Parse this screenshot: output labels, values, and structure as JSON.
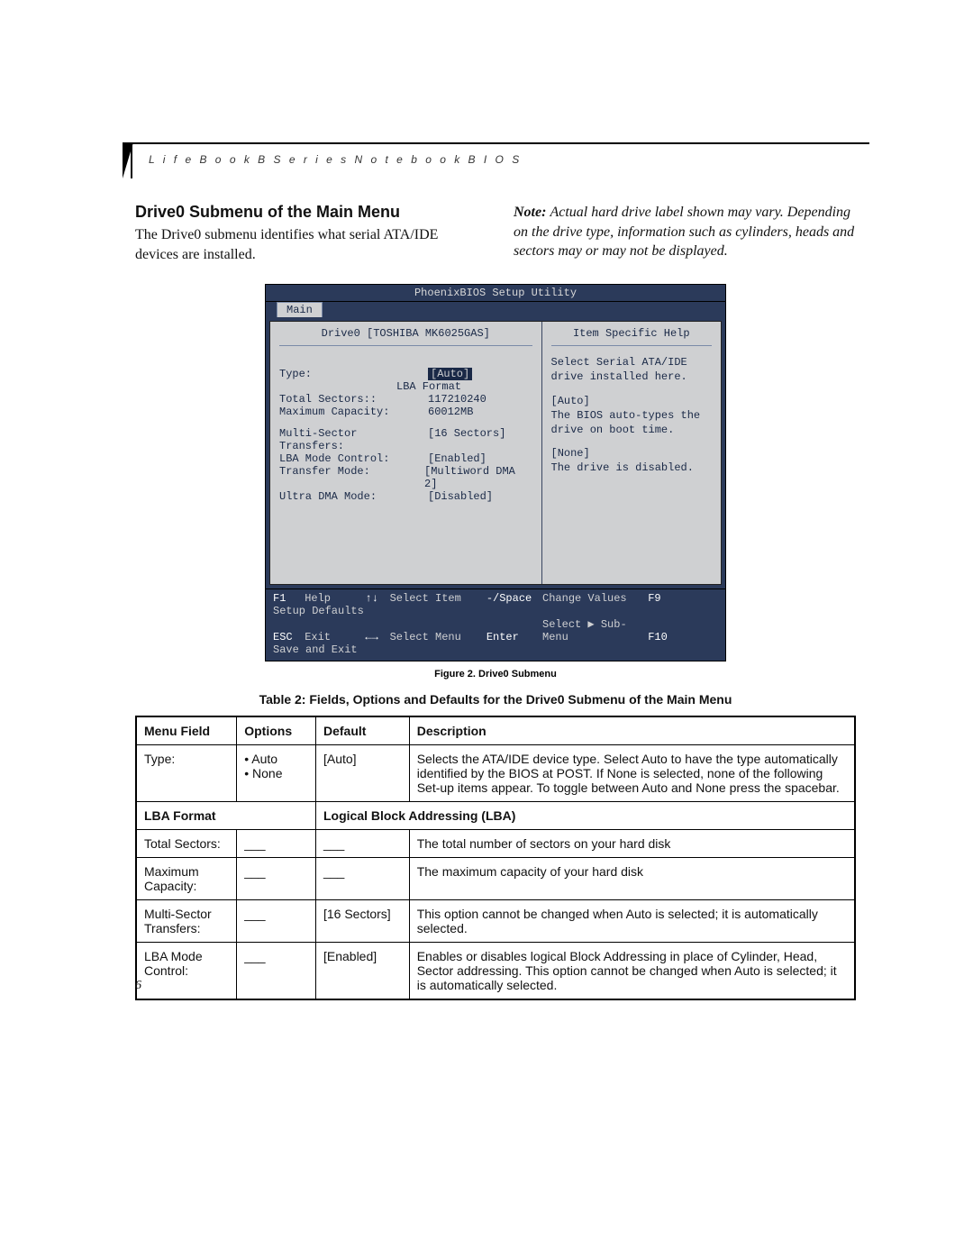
{
  "running_head": "L i f e B o o k   B   S e r i e s   N o t e b o o k   B I O S",
  "section_heading": "Drive0 Submenu of the Main Menu",
  "section_body": "The Drive0 submenu identifies what serial ATA/IDE devices are installed.",
  "note_label": "Note:",
  "note_body": "Actual hard drive label shown may vary. Depending on the drive type, information such as cylinders, heads and sectors may or may not be displayed.",
  "bios": {
    "title": "PhoenixBIOS Setup Utility",
    "tab": "Main",
    "left_title": "Drive0 [TOSHIBA MK6025GAS]",
    "right_title": "Item Specific Help",
    "fields": {
      "type_label": "Type:",
      "type_value": "[Auto]",
      "lba_format": "LBA Format",
      "total_sectors_label": "Total Sectors::",
      "total_sectors_value": "117210240",
      "max_capacity_label": "Maximum Capacity:",
      "max_capacity_value": "60012MB",
      "multi_sector_label": "Multi-Sector Transfers:",
      "multi_sector_value": "[16 Sectors]",
      "lba_mode_label": "LBA Mode Control:",
      "lba_mode_value": "[Enabled]",
      "transfer_mode_label": "Transfer Mode:",
      "transfer_mode_value": "[Multiword DMA 2]",
      "ultra_dma_label": "Ultra DMA Mode:",
      "ultra_dma_value": "[Disabled]"
    },
    "help": {
      "l1": "Select Serial ATA/IDE",
      "l2": "drive installed here.",
      "auto_label": "[Auto]",
      "auto_l1": "The BIOS auto-types the",
      "auto_l2": "drive on boot time.",
      "none_label": "[None]",
      "none_l1": "The drive is disabled."
    },
    "footer": {
      "f1": "F1",
      "help": "Help",
      "updown": "↑↓",
      "select_item": "Select Item",
      "minus_space": "-/Space",
      "change_values": "Change Values",
      "f9": "F9",
      "setup_defaults": "Setup Defaults",
      "esc": "ESC",
      "exit": "Exit",
      "leftright": "←→",
      "select_menu": "Select Menu",
      "enter": "Enter",
      "select_sub": "Select ▶ Sub-Menu",
      "f10": "F10",
      "save_exit": "Save and Exit"
    }
  },
  "figure_caption": "Figure 2.  Drive0 Submenu",
  "table_caption": "Table 2: Fields, Options and Defaults for the Drive0 Submenu of the Main Menu",
  "table": {
    "headers": {
      "c1": "Menu Field",
      "c2": "Options",
      "c3": "Default",
      "c4": "Description"
    },
    "rows": {
      "type": {
        "field": "Type:",
        "opt1": "Auto",
        "opt2": "None",
        "default": "[Auto]",
        "desc": "Selects the ATA/IDE device type. Select Auto to have the type automatically identified by the BIOS at POST. If None is selected, none of the following Set-up items appear. To toggle between Auto and None press the spacebar."
      },
      "lba_section": {
        "left": "LBA Format",
        "right": "Logical Block Addressing (LBA)"
      },
      "total_sectors": {
        "field": "Total Sectors:",
        "opt": "___",
        "default": "___",
        "desc": "The total number of sectors on your hard disk"
      },
      "max_capacity": {
        "field": "Maximum Capacity:",
        "opt": "___",
        "default": "___",
        "desc": "The maximum capacity of your hard disk"
      },
      "multi_sector": {
        "field": "Multi-Sector Transfers:",
        "opt": "___",
        "default": "[16 Sectors]",
        "desc": "This option cannot be changed when Auto is selected; it is automatically selected."
      },
      "lba_mode": {
        "field": "LBA Mode Control:",
        "opt": "___",
        "default": "[Enabled]",
        "desc": "Enables or disables logical Block Addressing in place of Cylinder, Head, Sector addressing. This option cannot be changed when Auto is selected; it is automatically selected."
      }
    }
  },
  "page_number": "6"
}
